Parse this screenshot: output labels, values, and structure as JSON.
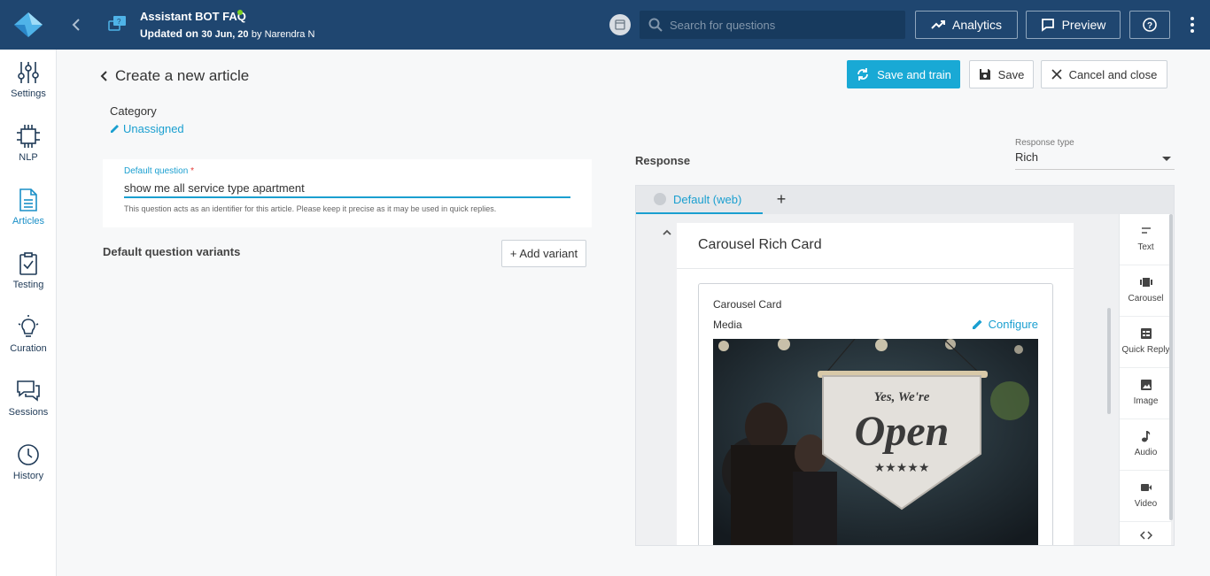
{
  "header": {
    "back_icon": "chevron-left-icon",
    "bot_name": "Assistant BOT FAQ",
    "updated_prefix": "Updated on",
    "updated_date": "30 Jun, 20",
    "updated_by": "by Narendra N",
    "search_placeholder": "Search for questions",
    "analytics_label": "Analytics",
    "preview_label": "Preview",
    "colors": {
      "bar": "#1f4670",
      "online": "#7ed321"
    }
  },
  "sidebar": {
    "items": [
      {
        "label": "Settings",
        "icon": "sliders-icon"
      },
      {
        "label": "NLP",
        "icon": "chip-icon"
      },
      {
        "label": "Articles",
        "icon": "document-icon",
        "active": true
      },
      {
        "label": "Testing",
        "icon": "clipboard-check-icon"
      },
      {
        "label": "Curation",
        "icon": "lightbulb-icon"
      },
      {
        "label": "Sessions",
        "icon": "chat-icon"
      },
      {
        "label": "History",
        "icon": "clock-icon"
      }
    ]
  },
  "page": {
    "title": "Create a new article",
    "save_train_label": "Save and train",
    "save_label": "Save",
    "cancel_label": "Cancel and close"
  },
  "category": {
    "label": "Category",
    "value": "Unassigned"
  },
  "question": {
    "label": "Default question",
    "required_mark": "*",
    "value": "show me all service type apartment",
    "help": "This question acts as an identifier for this article. Please keep it precise as it may be used in quick replies."
  },
  "variants": {
    "title": "Default question variants",
    "add_label": "+ Add variant"
  },
  "response": {
    "title": "Response",
    "type_label": "Response type",
    "type_value": "Rich",
    "tab_label": "Default (web)",
    "add_tab": "+",
    "card_title": "Carousel Rich Card",
    "inner_title": "Carousel Card",
    "media_label": "Media",
    "configure_label": "Configure",
    "image_text_line1": "Yes, We're",
    "image_text_line2": "Open",
    "image_stars": "★★★★★"
  },
  "tools": [
    {
      "label": "Text",
      "icon": "text-icon"
    },
    {
      "label": "Carousel",
      "icon": "carousel-icon"
    },
    {
      "label": "Quick Reply",
      "icon": "quick-reply-icon"
    },
    {
      "label": "Image",
      "icon": "image-icon"
    },
    {
      "label": "Audio",
      "icon": "audio-icon"
    },
    {
      "label": "Video",
      "icon": "video-icon"
    },
    {
      "label": "",
      "icon": "code-icon"
    }
  ],
  "accent_color": "#19a9d5"
}
